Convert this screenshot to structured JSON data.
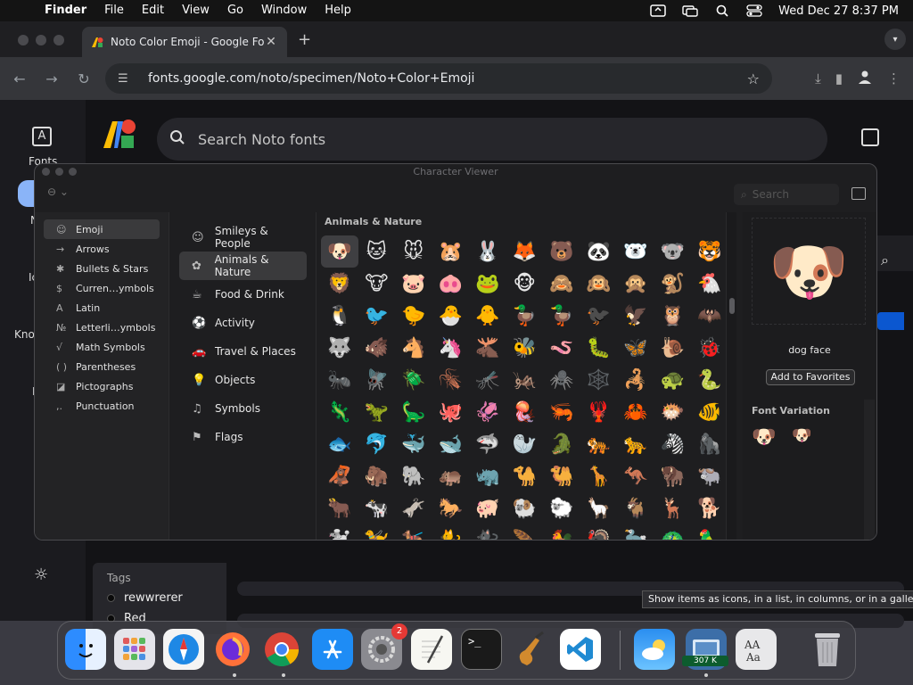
{
  "menubar": {
    "items": [
      "Finder",
      "File",
      "Edit",
      "View",
      "Go",
      "Window",
      "Help"
    ],
    "datetime": "Wed Dec 27  8:37 PM"
  },
  "browser": {
    "tab_title": "Noto Color Emoji - Google Fo",
    "url": "fonts.google.com/noto/specimen/Noto+Color+Emoji"
  },
  "page": {
    "search_placeholder": "Search Noto fonts",
    "rail": [
      "Fonts",
      "N",
      "Ic",
      "Kno",
      "I"
    ],
    "tags_label": "Tags",
    "tags": [
      "rewwrerer",
      "Red"
    ],
    "tooltip": "Show items as icons, in a list, in columns, or in a gallery"
  },
  "viewer": {
    "title": "Character Viewer",
    "search_placeholder": "Search",
    "side_items": [
      {
        "icon": "☺",
        "label": "Emoji"
      },
      {
        "icon": "→",
        "label": "Arrows"
      },
      {
        "icon": "✱",
        "label": "Bullets & Stars"
      },
      {
        "icon": "$",
        "label": "Curren…ymbols"
      },
      {
        "icon": "A",
        "label": "Latin"
      },
      {
        "icon": "№",
        "label": "Letterli…ymbols"
      },
      {
        "icon": "√",
        "label": "Math Symbols"
      },
      {
        "icon": "( )",
        "label": "Parentheses"
      },
      {
        "icon": "◪",
        "label": "Pictographs"
      },
      {
        "icon": ",.",
        "label": "Punctuation"
      }
    ],
    "categories": [
      {
        "icon": "☺",
        "label": "Smileys & People"
      },
      {
        "icon": "✿",
        "label": "Animals & Nature"
      },
      {
        "icon": "☕",
        "label": "Food & Drink"
      },
      {
        "icon": "⚽",
        "label": "Activity"
      },
      {
        "icon": "🚗",
        "label": "Travel & Places"
      },
      {
        "icon": "💡",
        "label": "Objects"
      },
      {
        "icon": "♫",
        "label": "Symbols"
      },
      {
        "icon": "⚑",
        "label": "Flags"
      }
    ],
    "grid_heading": "Animals & Nature",
    "emojis": [
      "🐶",
      "🐱",
      "🐭",
      "🐹",
      "🐰",
      "🦊",
      "🐻",
      "🐼",
      "🐻‍❄️",
      "🐨",
      "🐯",
      "🦁",
      "🐮",
      "🐷",
      "🐽",
      "🐸",
      "🐵",
      "🙈",
      "🙉",
      "🙊",
      "🐒",
      "🐔",
      "🐧",
      "🐦",
      "🐤",
      "🐣",
      "🐥",
      "🦆",
      "🦆",
      "🐦‍⬛",
      "🦅",
      "🦉",
      "🦇",
      "🐺",
      "🐗",
      "🐴",
      "🦄",
      "🫎",
      "🐝",
      "🪱",
      "🐛",
      "🦋",
      "🐌",
      "🐞",
      "🐜",
      "🪰",
      "🪲",
      "🪳",
      "🦟",
      "🦗",
      "🕷️",
      "🕸️",
      "🦂",
      "🐢",
      "🐍",
      "🦎",
      "🦖",
      "🦕",
      "🐙",
      "🦑",
      "🪼",
      "🦐",
      "🦞",
      "🦀",
      "🐡",
      "🐠",
      "🐟",
      "🐬",
      "🐳",
      "🐋",
      "🦈",
      "🦭",
      "🐊",
      "🐅",
      "🐆",
      "🦓",
      "🦍",
      "🦧",
      "🦣",
      "🐘",
      "🦛",
      "🦏",
      "🐪",
      "🐫",
      "🦒",
      "🦘",
      "🦬",
      "🐃",
      "🐂",
      "🐄",
      "🫏",
      "🐎",
      "🐖",
      "🐏",
      "🐑",
      "🦙",
      "🐐",
      "🦌",
      "🐕",
      "🐩",
      "🦮",
      "🐕‍🦺",
      "🐈",
      "🐈‍⬛",
      "🪶",
      "🐓",
      "🦃",
      "🦤",
      "🦚",
      "🦜"
    ],
    "selected_name": "dog face",
    "preview_emoji": "🐶",
    "add_favorites": "Add to Favorites",
    "font_variation_label": "Font Variation",
    "variations": [
      "🐶",
      "🐶"
    ]
  },
  "dock": {
    "netspeed": "307 K",
    "settings_badge": "2",
    "apps": [
      "finder-icon",
      "launchpad-icon",
      "safari-icon",
      "firefox-icon",
      "chrome-icon",
      "app-store-icon",
      "system-settings-icon",
      "textedit-icon",
      "terminal-icon",
      "garageband-icon",
      "vscode-icon",
      "weather-icon",
      "network-monitor-icon",
      "font-book-icon",
      "trash-icon"
    ]
  },
  "colors": {
    "accent": "#0b57d0"
  }
}
